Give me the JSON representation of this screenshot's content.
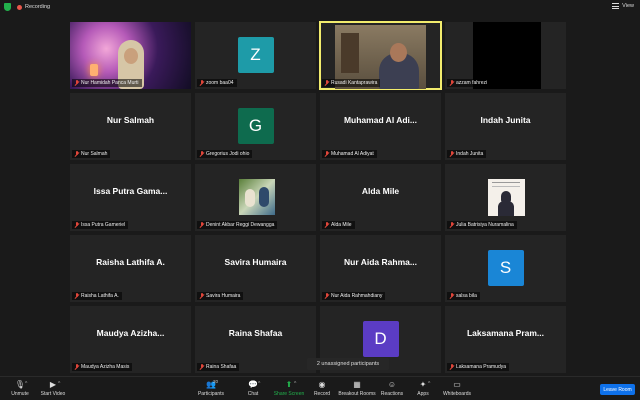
{
  "topbar": {
    "recording_label": "Recording",
    "view_label": "View"
  },
  "tiles": [
    {
      "name": "Nur Hamidah Panca Murti",
      "kind": "video-blossom"
    },
    {
      "name": "zoom baa04",
      "kind": "avatar",
      "initial": "Z",
      "color": "#1e9ba8"
    },
    {
      "name": "Rusadi Kantaprawira",
      "kind": "video-room",
      "active": true
    },
    {
      "name": "azzam fahrezi",
      "kind": "video-dark"
    },
    {
      "name": "Nur Salmah",
      "kind": "name",
      "display": "Nur Salmah"
    },
    {
      "name": "Gregorius Jodi ohio",
      "kind": "avatar",
      "initial": "G",
      "color": "#0e6b4e"
    },
    {
      "name": "Muhamad Al Adiyat",
      "kind": "name",
      "display": "Muhamad Al Adi..."
    },
    {
      "name": "Indah Junita",
      "kind": "name",
      "display": "Indah Junita"
    },
    {
      "name": "Issa Putra Gameriel",
      "kind": "name",
      "display": "Issa Putra Gama..."
    },
    {
      "name": "Denint Akbar Reggi Dewangga",
      "kind": "video-cartoon"
    },
    {
      "name": "Alda Mile",
      "kind": "name",
      "display": "Alda Mile"
    },
    {
      "name": "Julia Batrisiya Nuramalina",
      "kind": "video-portrait"
    },
    {
      "name": "Raisha Lathifa A.",
      "kind": "name",
      "display": "Raisha Lathifa A."
    },
    {
      "name": "Savira Humaira",
      "kind": "name",
      "display": "Savira Humaira"
    },
    {
      "name": "Nur Aida Rahmahdiany",
      "kind": "name",
      "display": "Nur Aida Rahma..."
    },
    {
      "name": "salsa bila",
      "kind": "avatar",
      "initial": "S",
      "color": "#1a86d6"
    },
    {
      "name": "Maudya Azizha Masis",
      "kind": "name",
      "display": "Maudya Azizha..."
    },
    {
      "name": "Raina Shafaa",
      "kind": "name",
      "display": "Raina Shafaa"
    },
    {
      "name": "",
      "kind": "avatar",
      "initial": "D",
      "color": "#5b3cc4"
    },
    {
      "name": "Laksamana Pramudya",
      "kind": "name",
      "display": "Laksamana Pram..."
    }
  ],
  "unassigned_label": "2 unassigned participants",
  "toolbar": {
    "unmute": "Unmute",
    "start_video": "Start Video",
    "participants": "Participants",
    "participants_count": "20",
    "chat": "Chat",
    "share_screen": "Share Screen",
    "record": "Record",
    "breakout_rooms": "Breakout Rooms",
    "reactions": "Reactions",
    "apps": "Apps",
    "whiteboards": "Whiteboards",
    "leave_room": "Leave Room"
  },
  "colors": {
    "active_speaker": "#f2ec6d",
    "leave_button": "#0e71eb",
    "share_green": "#22b14c"
  }
}
